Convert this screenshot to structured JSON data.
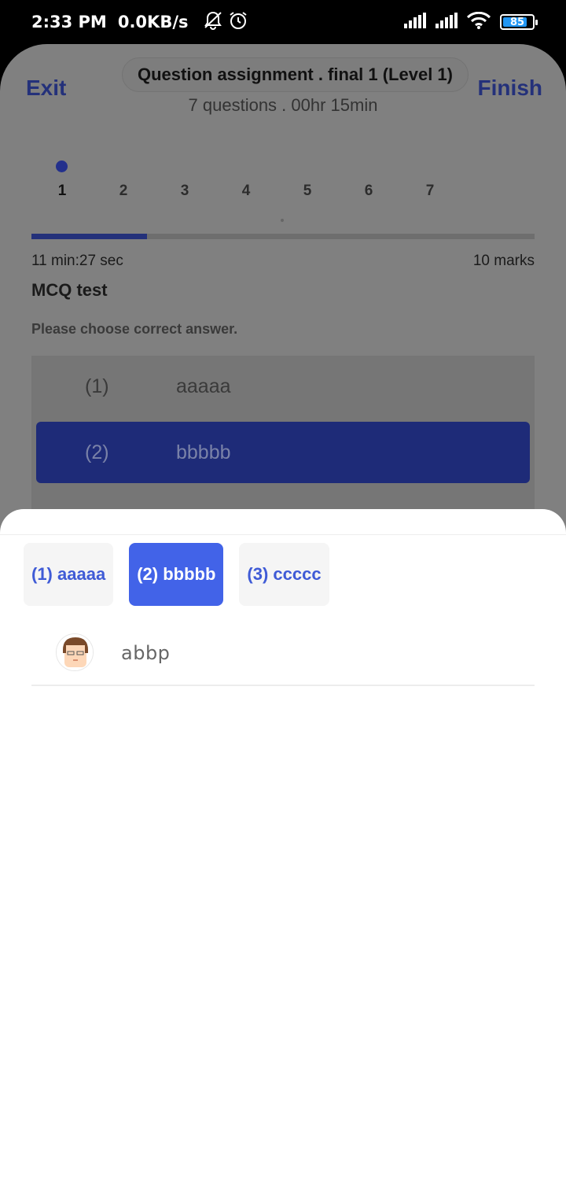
{
  "status_bar": {
    "time": "2:33 PM",
    "network_speed": "0.0KB/s",
    "icons": [
      "bell-off-icon",
      "alarm-icon",
      "signal-icon",
      "signal-icon",
      "wifi-icon"
    ],
    "battery_level": "85",
    "battery_color": "#2196f3"
  },
  "header": {
    "exit_label": "Exit",
    "finish_label": "Finish",
    "title": "Question assignment . final 1 (Level 1)",
    "subtitle": "7 questions . 00hr 15min"
  },
  "question_nav": {
    "items": [
      "1",
      "2",
      "3",
      "4",
      "5",
      "6",
      "7"
    ],
    "current": "1",
    "progress_fraction": 0.23
  },
  "question": {
    "timer": "11 min:27 sec",
    "marks": "10 marks",
    "title": "MCQ test",
    "instruction": "Please choose correct answer."
  },
  "options": [
    {
      "num": "(1)",
      "text": "aaaaa",
      "selected": false
    },
    {
      "num": "(2)",
      "text": "bbbbb",
      "selected": true
    }
  ],
  "sheet": {
    "chips": [
      {
        "label": "(1) aaaaa",
        "selected": false
      },
      {
        "label": "(2) bbbbb",
        "selected": true
      },
      {
        "label": "(3) ccccc",
        "selected": false
      }
    ],
    "answer_user": "abbp"
  },
  "colors": {
    "accent": "#4263e8",
    "header_accent": "#24317a",
    "overlay": "#808080"
  }
}
